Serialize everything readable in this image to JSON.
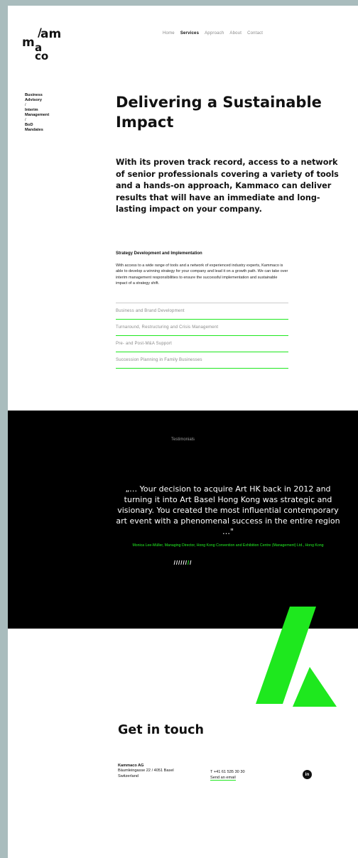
{
  "brand": {
    "logo_m": "m",
    "logo_slash": "/",
    "logo_am": "am",
    "logo_a": "a",
    "logo_co": "co",
    "accent_color": "#1ee81e"
  },
  "nav": {
    "items": [
      {
        "label": "Home",
        "active": false
      },
      {
        "label": "Services",
        "active": true
      },
      {
        "label": "Approach",
        "active": false
      },
      {
        "label": "About",
        "active": false
      },
      {
        "label": "Contact",
        "active": false
      }
    ]
  },
  "sidenav": {
    "items": [
      {
        "line1": "Business",
        "line2": "Advisory"
      },
      {
        "line1": "Interim",
        "line2": "Management"
      },
      {
        "line1": "BoD",
        "line2": "Mandates"
      }
    ],
    "separator": "/"
  },
  "main": {
    "headline": "Delivering a Sustainable Impact",
    "intro": "With its proven track record, access to a network of senior professionals covering a variety of tools and a hands-on approach, Kammaco can deliver results that will have an immediate and long-lasting impact on your company.",
    "service": {
      "title": "Strategy Development and Implementation",
      "body": "With access to a wide range of tools and a network of experienced industry experts, Kammaco is able to develop a winning strategy for your company and lead it on a growth path. We can take over interim management responsibilities to ensure the successful implementation and sustainable impact of a strategy shift."
    },
    "accordion": [
      "Business and Brand Development",
      "Turnaround, Restructuring and Crisis Management",
      "Pre- and Post-M&A Support",
      "Succession Planning in Family Businesses"
    ]
  },
  "testimonial": {
    "heading": "Testimonials",
    "quote": "„… Your decision to acquire Art HK back in 2012 and turning it into Art Basel Hong Kong was strategic and visionary. You created the most influential contemporary art event with a phenomenal success in the entire region …\"",
    "author": "Monica Lee-Müller, Managing Director, Hong Kong Convention and Exhibition Centre (Management) Ltd., Hong Kong",
    "slashes_white_a": "//////",
    "slashes_green": "/",
    "slashes_white_b": "/",
    "active_slide": 7,
    "total_slides": 8
  },
  "contact": {
    "title": "Get in touch",
    "company": "Kammaco AG",
    "street": "Bäumleingasse 22 / 4051 Basel",
    "country": "Switzerland",
    "phone": "T +41 61 535 30 30",
    "email_label": "Send an email",
    "linkedin_label": "in"
  }
}
